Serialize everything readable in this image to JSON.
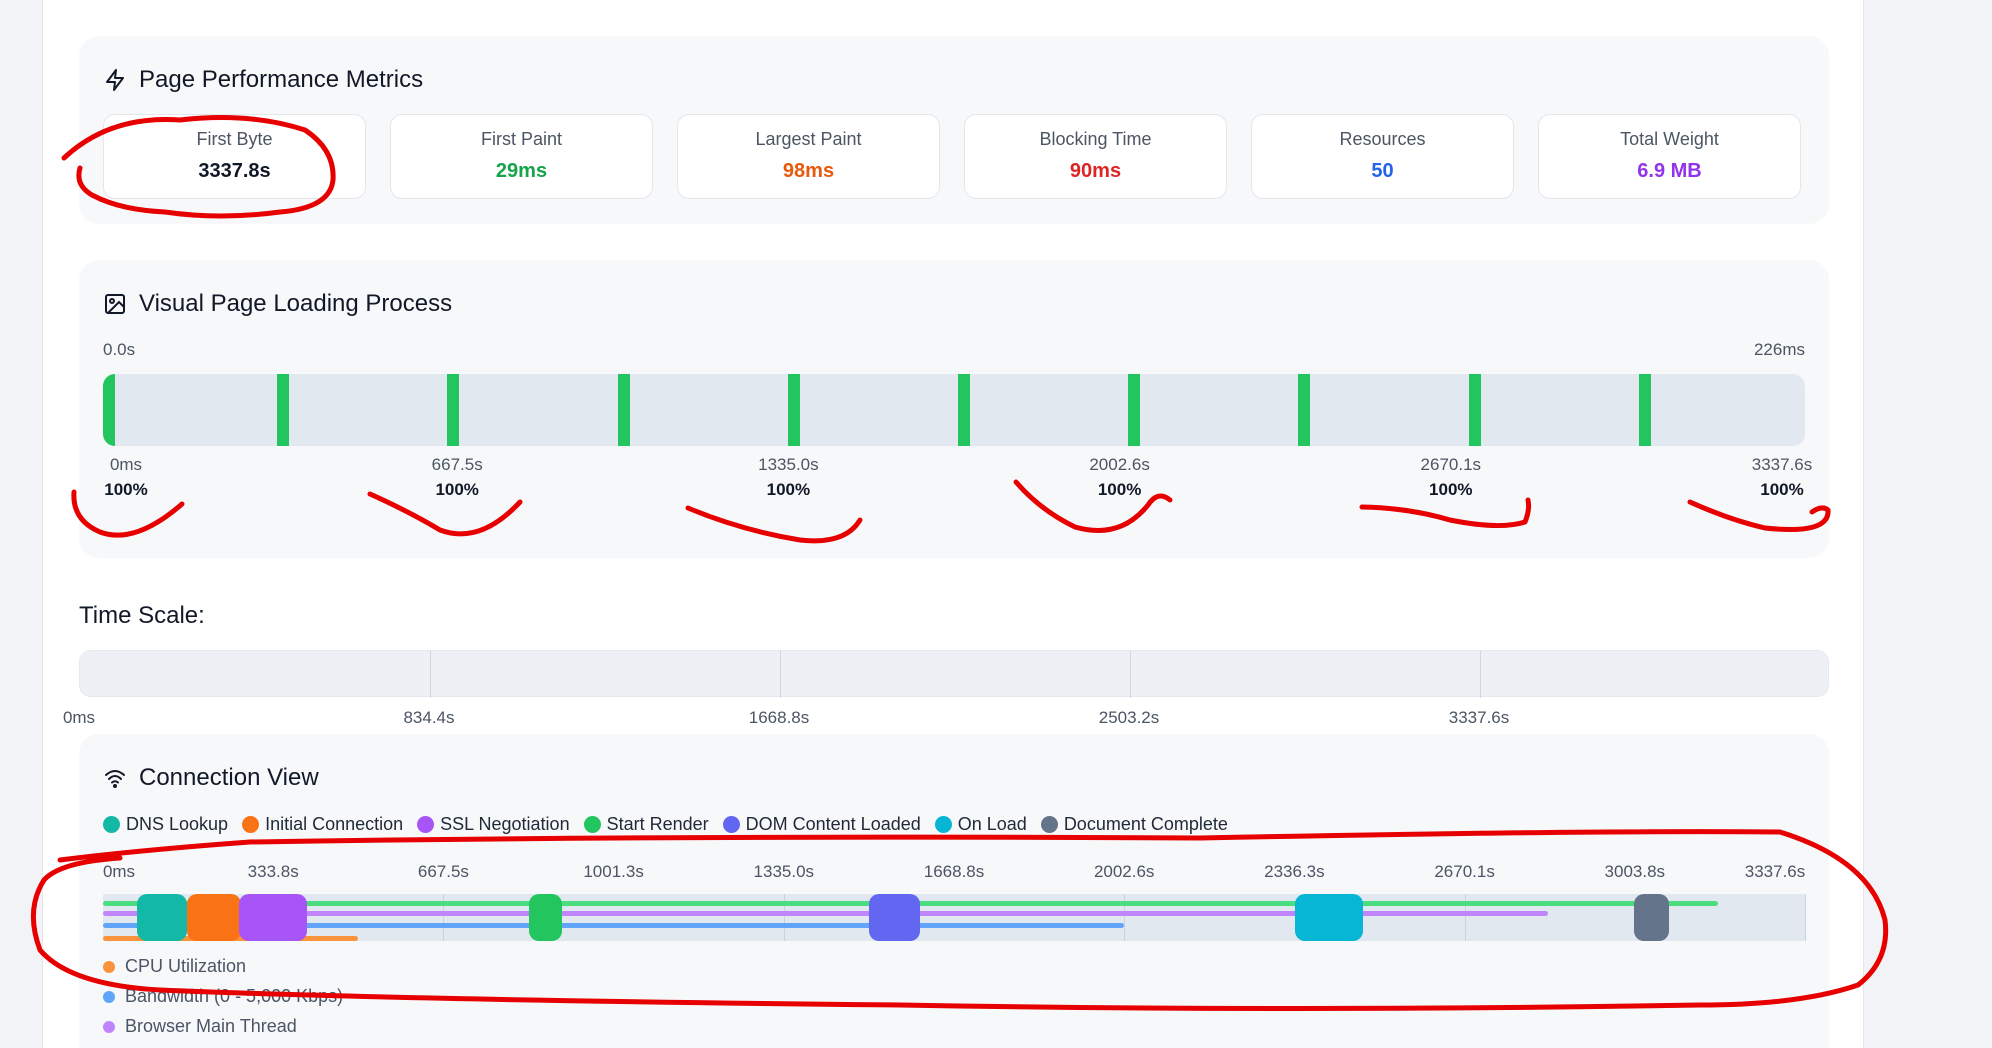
{
  "metrics_panel": {
    "title": "Page Performance Metrics",
    "items": [
      {
        "label": "First Byte",
        "value": "3337.8s",
        "color": "#111827"
      },
      {
        "label": "First Paint",
        "value": "29ms",
        "color": "#16a34a"
      },
      {
        "label": "Largest Paint",
        "value": "98ms",
        "color": "#ea580c"
      },
      {
        "label": "Blocking Time",
        "value": "90ms",
        "color": "#dc2626"
      },
      {
        "label": "Resources",
        "value": "50",
        "color": "#2563eb"
      },
      {
        "label": "Total Weight",
        "value": "6.9 MB",
        "color": "#9333ea"
      }
    ]
  },
  "visual_panel": {
    "title": "Visual Page Loading Process",
    "start_label": "0.0s",
    "end_label": "226ms",
    "frame_count": 10,
    "frames": [
      {
        "time": "0ms",
        "pct": "100%"
      },
      {
        "time": "667.5s",
        "pct": "100%"
      },
      {
        "time": "1335.0s",
        "pct": "100%"
      },
      {
        "time": "2002.6s",
        "pct": "100%"
      },
      {
        "time": "2670.1s",
        "pct": "100%"
      },
      {
        "time": "3337.6s",
        "pct": "100%"
      }
    ]
  },
  "time_scale": {
    "title": "Time Scale:",
    "ticks": [
      "0ms",
      "834.4s",
      "1668.8s",
      "2503.2s",
      "3337.6s"
    ]
  },
  "connection_panel": {
    "title": "Connection View",
    "legend": [
      {
        "label": "DNS Lookup",
        "color": "#14b8a6"
      },
      {
        "label": "Initial Connection",
        "color": "#f97316"
      },
      {
        "label": "SSL Negotiation",
        "color": "#a855f7"
      },
      {
        "label": "Start Render",
        "color": "#22c55e"
      },
      {
        "label": "DOM Content Loaded",
        "color": "#6366f1"
      },
      {
        "label": "On Load",
        "color": "#06b6d4"
      },
      {
        "label": "Document Complete",
        "color": "#64748b"
      }
    ],
    "axis": [
      "0ms",
      "333.8s",
      "667.5s",
      "1001.3s",
      "1335.0s",
      "1668.8s",
      "2002.6s",
      "2336.3s",
      "2670.1s",
      "3003.8s",
      "3337.6s"
    ],
    "sub_legend": [
      {
        "label": "CPU Utilization",
        "color": "#fb923c"
      },
      {
        "label": "Bandwidth (0 - 5,000 Kbps)",
        "color": "#60a5fa"
      },
      {
        "label": "Browser Main Thread",
        "color": "#c084fc"
      }
    ]
  }
}
